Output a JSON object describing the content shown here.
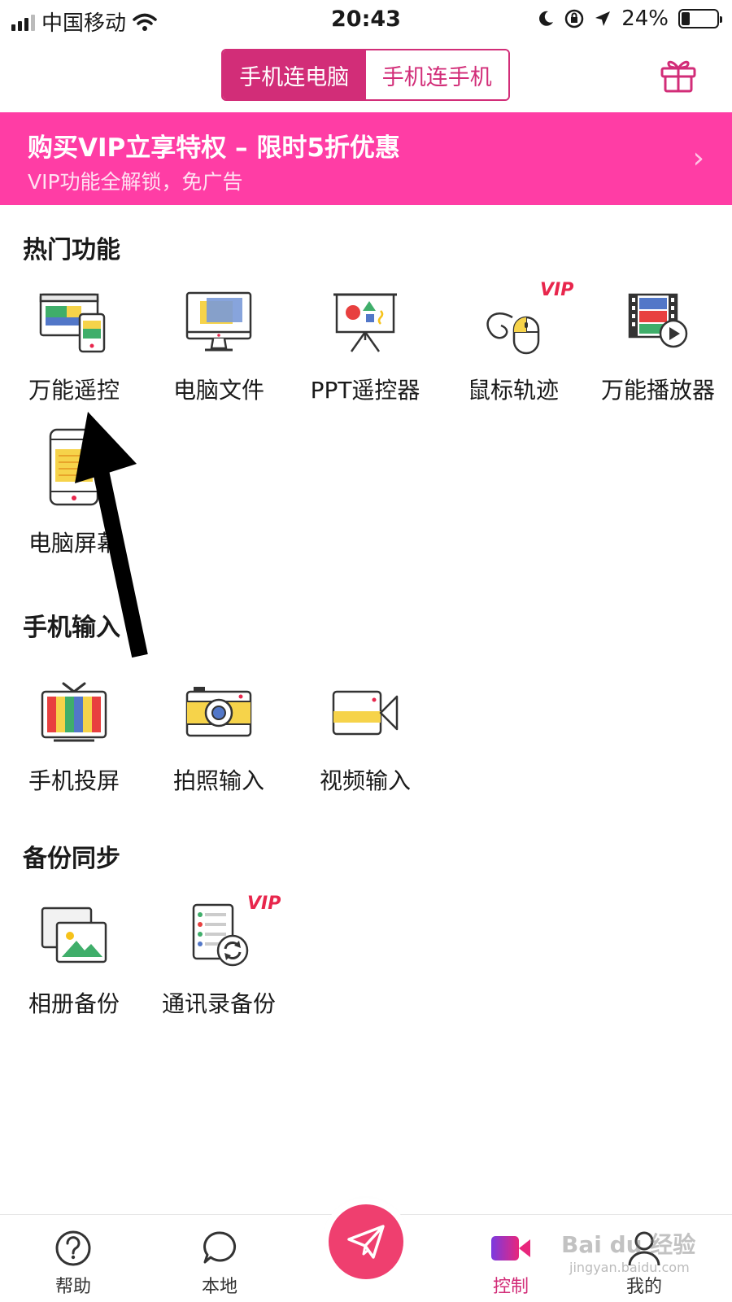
{
  "status": {
    "carrier": "中国移动",
    "time": "20:43",
    "battery": "24%"
  },
  "tabs_top": [
    {
      "label": "手机连电脑"
    },
    {
      "label": "手机连手机"
    }
  ],
  "banner": {
    "title": "购买VIP立享特权 – 限时5折优惠",
    "subtitle": "VIP功能全解锁，免广告",
    "chevron": "›"
  },
  "sections": {
    "hot": {
      "title": "热门功能",
      "items": [
        "万能遥控",
        "电脑文件",
        "PPT遥控器",
        "鼠标轨迹",
        "万能播放器",
        "电脑屏幕"
      ]
    },
    "input": {
      "title": "手机输入",
      "items": [
        "手机投屏",
        "拍照输入",
        "视频输入"
      ]
    },
    "backup": {
      "title": "备份同步",
      "items": [
        "相册备份",
        "通讯录备份"
      ]
    }
  },
  "vip_badge": "VIP",
  "bottom_tabs": [
    {
      "label": "帮助"
    },
    {
      "label": "本地"
    },
    {
      "label": "控制"
    },
    {
      "label": "我的"
    }
  ],
  "watermark": {
    "brand": "Bai du 经验",
    "url": "jingyan.baidu.com"
  },
  "colors": {
    "accent": "#d22d78",
    "banner": "#ff3da5",
    "send": "#ef3f6f"
  }
}
